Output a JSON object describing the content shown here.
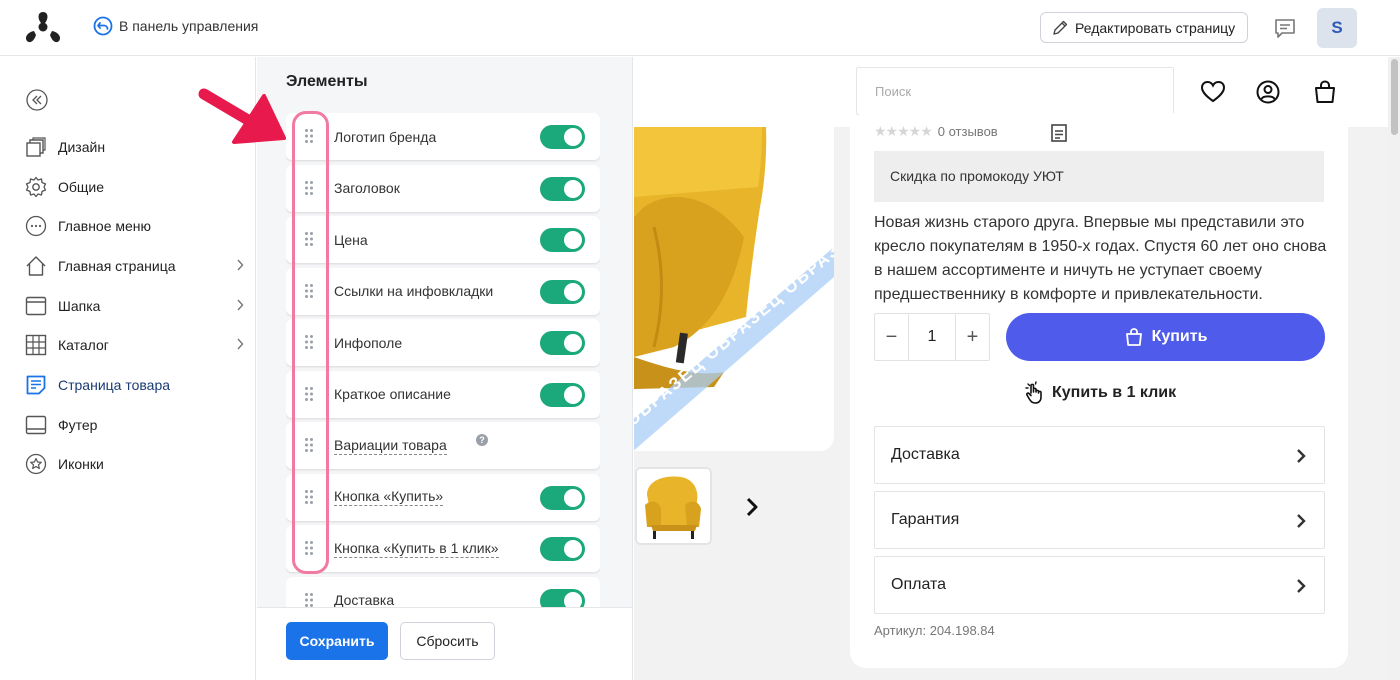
{
  "topbar": {
    "back_label": "В панель управления",
    "edit_label": "Редактировать страницу",
    "avatar_letter": "S"
  },
  "sidebar": {
    "items": [
      {
        "label": "Дизайн",
        "icon": "design-icon",
        "has_chevron": false
      },
      {
        "label": "Общие",
        "icon": "gear-icon",
        "has_chevron": false
      },
      {
        "label": "Главное меню",
        "icon": "menu-dots-icon",
        "has_chevron": false
      },
      {
        "label": "Главная страница",
        "icon": "home-icon",
        "has_chevron": true
      },
      {
        "label": "Шапка",
        "icon": "header-icon",
        "has_chevron": true
      },
      {
        "label": "Каталог",
        "icon": "grid-icon",
        "has_chevron": true
      },
      {
        "label": "Страница товара",
        "icon": "product-page-icon",
        "has_chevron": false,
        "active": true
      },
      {
        "label": "Футер",
        "icon": "footer-icon",
        "has_chevron": false
      },
      {
        "label": "Иконки",
        "icon": "star-icon",
        "has_chevron": false
      }
    ]
  },
  "panel": {
    "title": "Элементы",
    "elements": [
      {
        "label": "Логотип бренда",
        "toggle": true
      },
      {
        "label": "Заголовок",
        "toggle": true
      },
      {
        "label": "Цена",
        "toggle": true
      },
      {
        "label": "Ссылки на инфовкладки",
        "toggle": true
      },
      {
        "label": "Инфополе",
        "toggle": true
      },
      {
        "label": "Краткое описание",
        "toggle": true
      },
      {
        "label": "Вариации товара",
        "toggle": false,
        "help": "?"
      },
      {
        "label": "Кнопка «Купить»",
        "toggle": true
      },
      {
        "label": "Кнопка «Купить в 1 клик»",
        "toggle": true
      },
      {
        "label": "Доставка",
        "toggle": true
      }
    ],
    "save_label": "Сохранить",
    "reset_label": "Сбросить"
  },
  "preview": {
    "search_placeholder": "Поиск",
    "watermark": "ОБРАЗЕЦ ОБРАЗЕЦ ОБРАЗЕЦ",
    "reviews": "0 отзывов",
    "promo": "Скидка по промокоду УЮТ",
    "description": "Новая жизнь старого друга. Впервые мы представили это кресло покупателям в 1950-х годах. Спустя 60 лет оно снова в нашем ассортименте и ничуть не уступает своему предшественнику в комфорте и привлекательности.",
    "qty_minus": "−",
    "qty_value": "1",
    "qty_plus": "+",
    "buy_label": "Купить",
    "oneclick_label": "Купить в 1 клик",
    "accordion": [
      "Доставка",
      "Гарантия",
      "Оплата"
    ],
    "sku": "Артикул: 204.198.84"
  },
  "colors": {
    "toggle_on": "#1ba87a",
    "save_button": "#1a73e8",
    "buy_button": "#4f5bea",
    "highlight": "#f07aa0",
    "arrow": "#e8194c"
  }
}
